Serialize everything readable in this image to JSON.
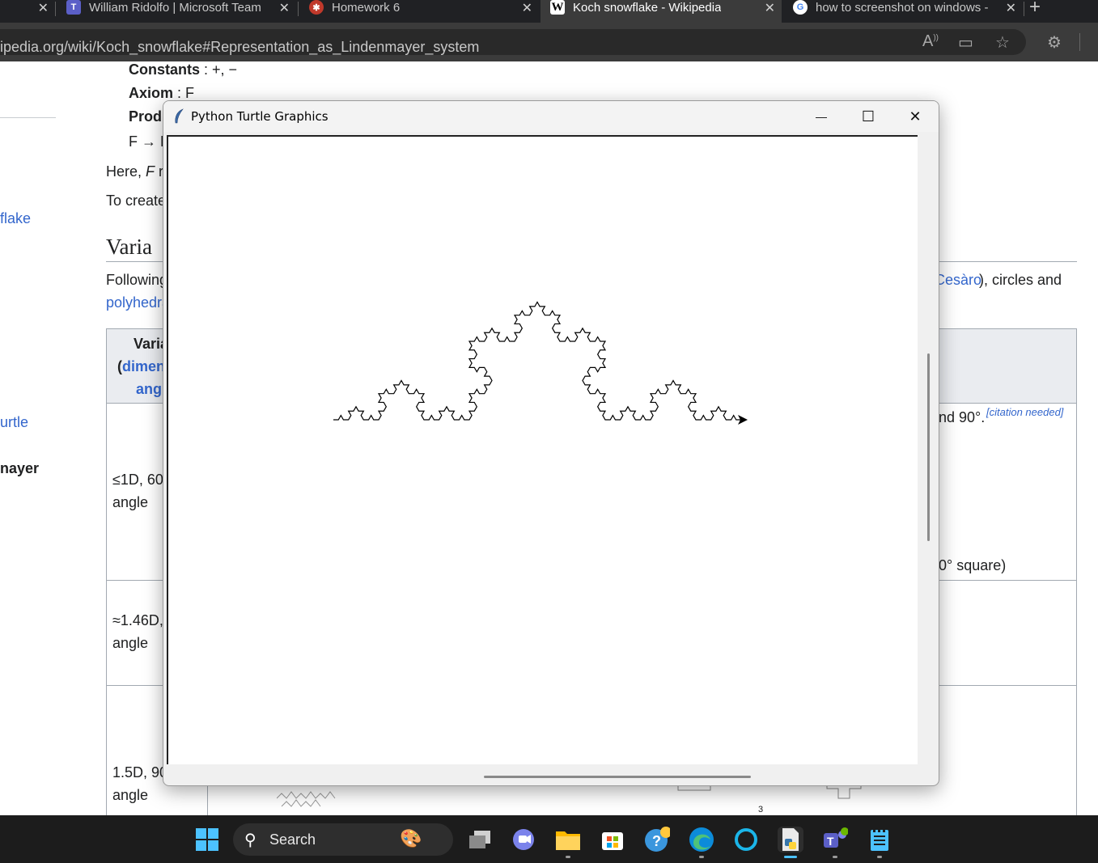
{
  "browser": {
    "tabs": [
      {
        "title": "",
        "icon": "close-icon"
      },
      {
        "title": "William Ridolfo | Microsoft Team",
        "icon": "teams-icon"
      },
      {
        "title": "Homework 6",
        "icon": "homework-icon"
      },
      {
        "title": "Koch snowflake - Wikipedia",
        "icon": "wikipedia-icon",
        "active": true
      },
      {
        "title": "how to screenshot on windows -",
        "icon": "google-icon"
      }
    ],
    "new_tab_glyph": "+",
    "close_glyph": "✕",
    "url": "ipedia.org/wiki/Koch_snowflake#Representation_as_Lindenmayer_system",
    "url_icons": [
      "read-aloud-icon",
      "immersive-reader-icon",
      "favorites-icon",
      "extensions-icon"
    ]
  },
  "wiki": {
    "constants_label": "Constants",
    "constants_value": " : +, −",
    "axiom_label": "Axiom",
    "axiom_value": " : F",
    "productions_label": "Prod",
    "production_rule": "F → F",
    "here_prefix": "Here, ",
    "here_italic": "F",
    "here_rest": " r",
    "to_create": "To create",
    "sidebar_link1": "flake",
    "sidebar_link2": "urtle",
    "sidebar_bold": "nayer",
    "variants_heading": "Varia",
    "following": "Following",
    "cesaro_link": "Cesàro",
    "circles_and": "), circles and",
    "polyhedra_link": "polyhedra",
    "table_header": {
      "line1": "Varia",
      "line2_open": "(",
      "line2_link": "dimen",
      "line3_link": "ang"
    },
    "rows": [
      {
        "line1": "≤1D, 60",
        "line2": "angle"
      },
      {
        "line1": "≈1.46D,",
        "line2": "angle"
      },
      {
        "line1": "1.5D, 90",
        "line2": "angle"
      }
    ],
    "row1_right": "nd 90°.",
    "citation": "[citation needed]",
    "row1_right2": "0° square)",
    "page_number_fragment": "3"
  },
  "turtle_window": {
    "title": "Python Turtle Graphics",
    "minimize": "—",
    "maximize": "☐",
    "close": "✕"
  },
  "taskbar": {
    "search_label": "Search",
    "apps": [
      "start-icon",
      "task-view-icon",
      "chat-icon",
      "file-explorer-icon",
      "store-icon",
      "help-icon",
      "edge-icon",
      "cortana-icon",
      "python-file-icon",
      "teams-icon",
      "notepad-icon"
    ]
  }
}
